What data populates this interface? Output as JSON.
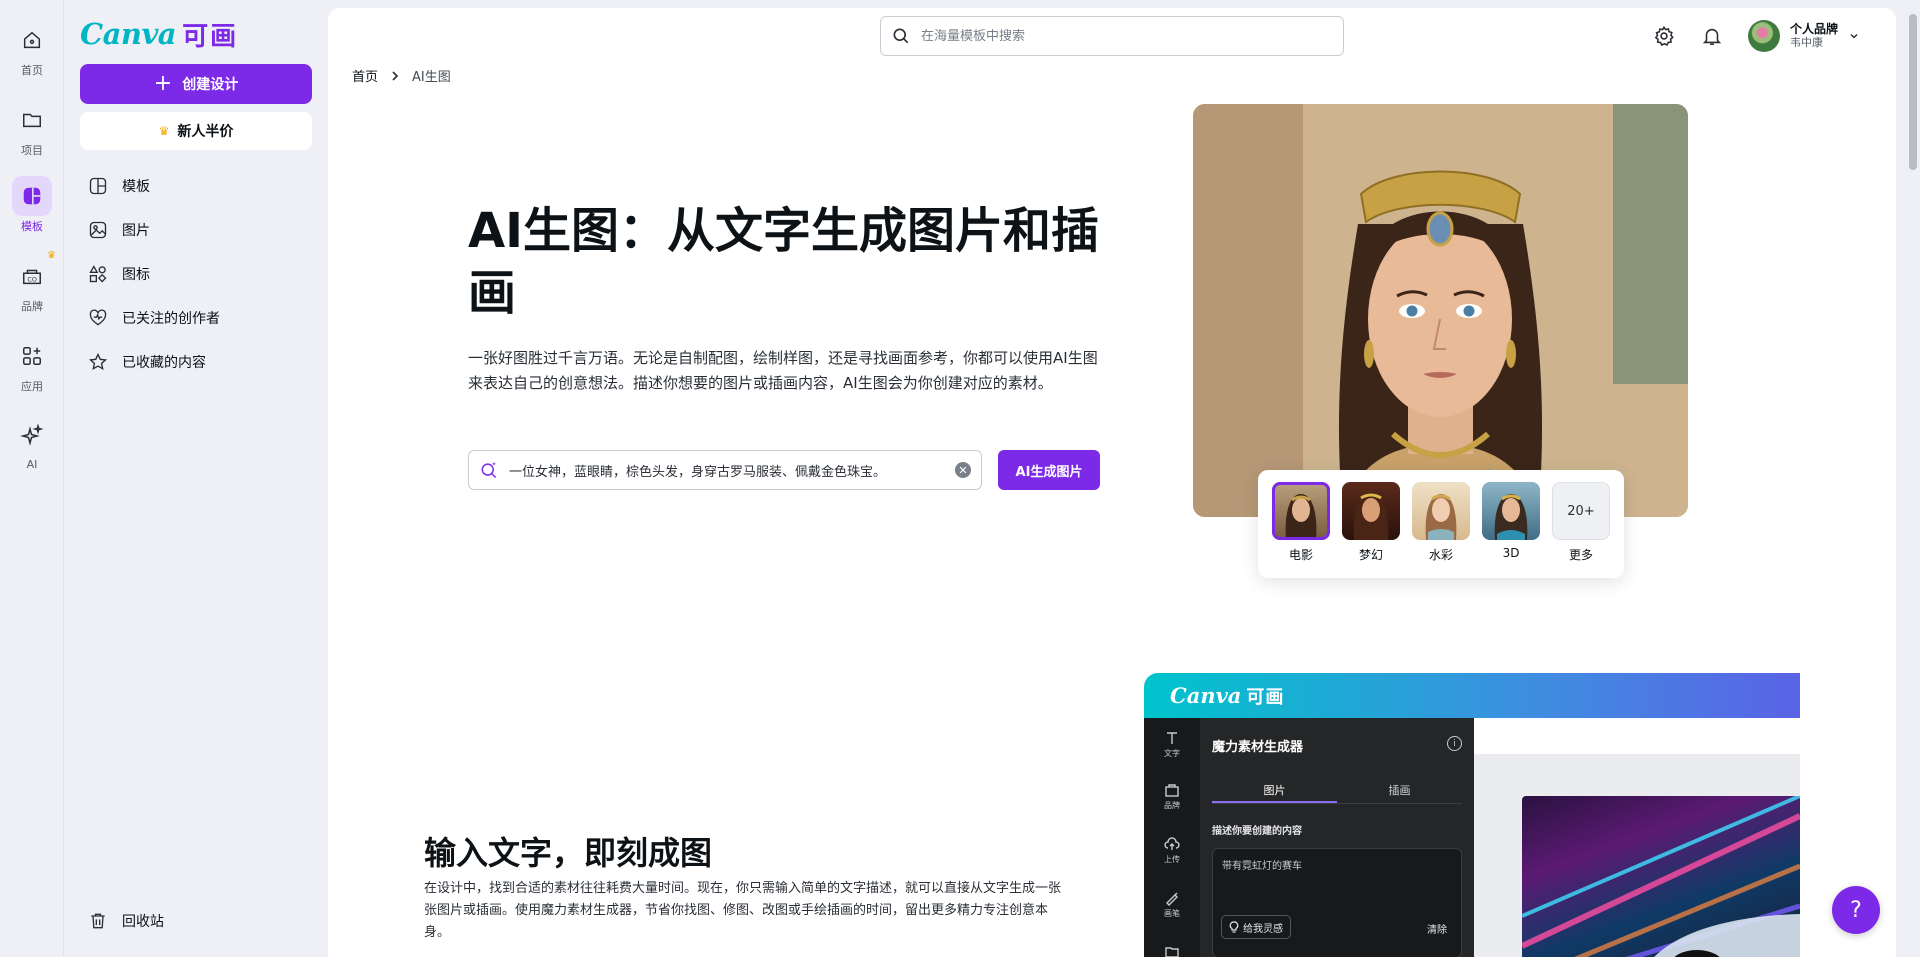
{
  "rail": {
    "items": [
      {
        "label": "首页",
        "icon": "home-icon"
      },
      {
        "label": "项目",
        "icon": "folder-icon"
      },
      {
        "label": "模板",
        "icon": "templates-icon"
      },
      {
        "label": "品牌",
        "icon": "brand-icon"
      },
      {
        "label": "应用",
        "icon": "apps-icon"
      },
      {
        "label": "AI",
        "icon": "sparkle-icon"
      }
    ],
    "active": "模板"
  },
  "sidebar": {
    "logo_latin": "Canva",
    "logo_cn": "可画",
    "create_label": "创建设计",
    "promo_label": "新人半价",
    "items": [
      {
        "label": "模板",
        "icon": "template-icon"
      },
      {
        "label": "图片",
        "icon": "image-icon"
      },
      {
        "label": "图标",
        "icon": "shapes-icon"
      },
      {
        "label": "已关注的创作者",
        "icon": "heart-icon"
      },
      {
        "label": "已收藏的内容",
        "icon": "star-icon"
      }
    ],
    "trash_label": "回收站"
  },
  "header": {
    "search_placeholder": "在海量模板中搜索",
    "account_name": "个人品牌",
    "account_sub": "韦中康"
  },
  "breadcrumb": {
    "home": "首页",
    "current": "AI生图"
  },
  "hero": {
    "title": "AI生图：从文字生成图片和插画",
    "description": "一张好图胜过千言万语。无论是自制配图，绘制样图，还是寻找画面参考，你都可以使用AI生图来表达自己的创意想法。描述你想要的图片或插画内容，AI生图会为你创建对应的素材。",
    "prompt_value": "一位女神，蓝眼睛，棕色头发，身穿古罗马服装、佩戴金色珠宝。",
    "generate_label": "AI生成图片",
    "styles": [
      {
        "label": "电影",
        "selected": true
      },
      {
        "label": "梦幻",
        "selected": false
      },
      {
        "label": "水彩",
        "selected": false
      },
      {
        "label": "3D",
        "selected": false
      }
    ],
    "more_badge": "20+",
    "more_label": "更多"
  },
  "section2": {
    "title": "输入文字，即刻成图",
    "description": "在设计中，找到合适的素材往往耗费大量时间。现在，你只需输入简单的文字描述，就可以直接从文字生成一张张图片或插画。使用魔力素材生成器，节省你找图、修图、改图或手绘插画的时间，留出更多精力专注创意本身。"
  },
  "mockup": {
    "logo_latin": "Canva",
    "logo_cn": "可画",
    "rail": [
      "文字",
      "品牌",
      "上传",
      "画笔"
    ],
    "panel_title": "魔力素材生成器",
    "tabs": [
      "图片",
      "插画"
    ],
    "field_label": "描述你要创建的内容",
    "field_value": "带有霓虹灯的赛车",
    "inspire_label": "给我灵感",
    "clear_label": "清除"
  },
  "help_label": "?",
  "colors": {
    "brand_purple": "#7d2ae8",
    "brand_teal": "#00c4cc"
  }
}
